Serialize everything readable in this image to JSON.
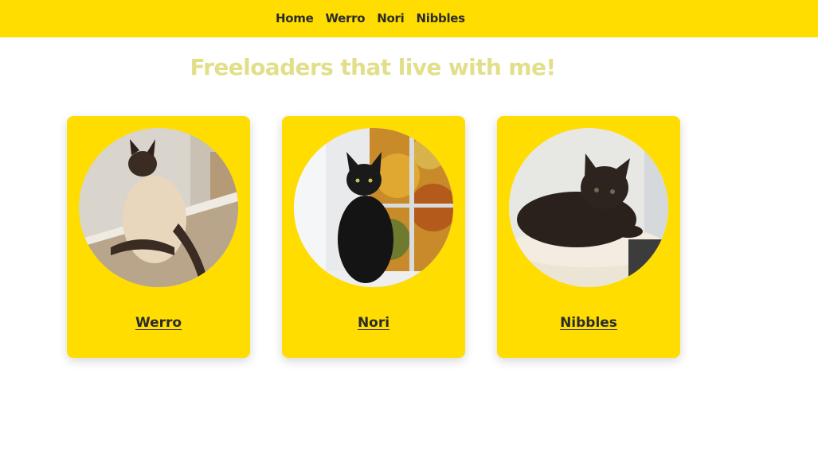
{
  "nav": {
    "links": [
      "Home",
      "Werro",
      "Nori",
      "Nibbles"
    ]
  },
  "page": {
    "title": "Freeloaders that live with me!"
  },
  "cats": [
    {
      "name": "Werro"
    },
    {
      "name": "Nori"
    },
    {
      "name": "Nibbles"
    }
  ],
  "colors": {
    "accent": "#FFDD00",
    "title": "#E2DF8A",
    "text": "#2b2b2b"
  }
}
